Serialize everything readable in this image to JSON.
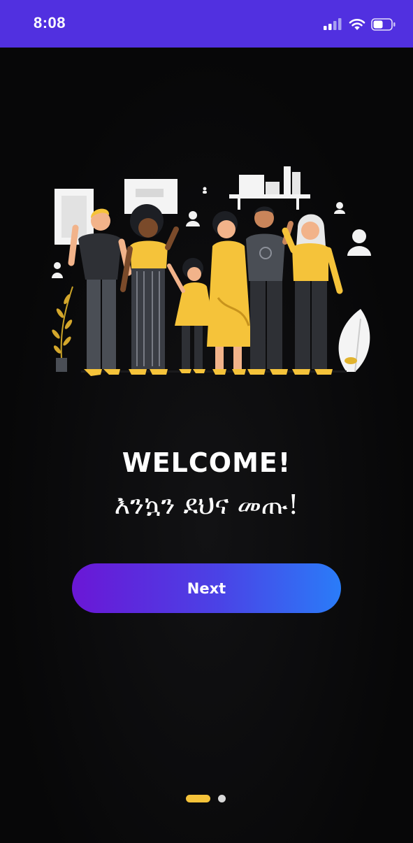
{
  "status_bar": {
    "time": "8:08",
    "background": "#5130e0",
    "icons": [
      "cellular-signal-icon",
      "wifi-icon",
      "battery-icon"
    ]
  },
  "illustration": {
    "icon": "team-illustration"
  },
  "welcome": {
    "title": "WELCOME!",
    "subtitle": "እንኳን ደህና መጡ!"
  },
  "next_button": {
    "label": "Next",
    "gradient": [
      "#6a17d6",
      "#2a7cf8"
    ]
  },
  "pager": {
    "active_index": 0,
    "total": 2,
    "active_color": "#f5c33a"
  }
}
